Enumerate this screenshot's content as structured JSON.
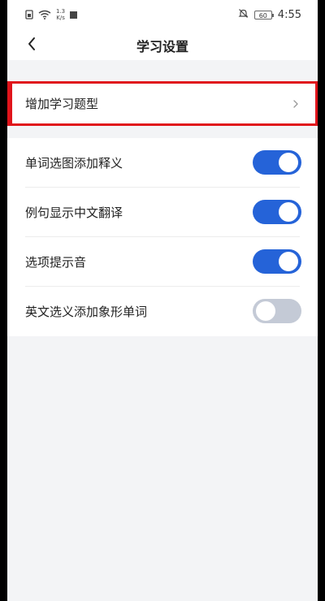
{
  "status_bar": {
    "net_speed_value": "1.3",
    "net_speed_unit": "K/s",
    "battery": "60",
    "time": "4:55"
  },
  "header": {
    "title": "学习设置"
  },
  "menu": {
    "add_question_types_label": "增加学习题型"
  },
  "settings": [
    {
      "label": "单词选图添加释义",
      "enabled": true
    },
    {
      "label": "例句显示中文翻译",
      "enabled": true
    },
    {
      "label": "选项提示音",
      "enabled": true
    },
    {
      "label": "英文选义添加象形单词",
      "enabled": false
    }
  ],
  "colors": {
    "toggle_on": "#2563d8",
    "toggle_off": "#c4cad6",
    "highlight": "#e0141b"
  }
}
